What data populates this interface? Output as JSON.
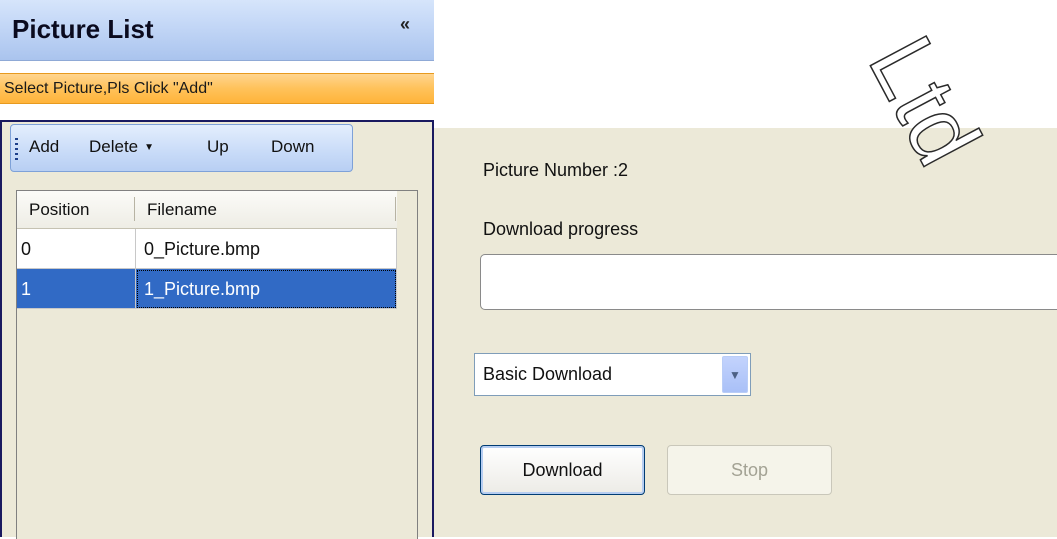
{
  "panel": {
    "title": "Picture List",
    "collapse_icon": "«",
    "hint": "Select Picture,Pls Click \"Add\""
  },
  "toolbar": {
    "add_label": "Add",
    "delete_label": "Delete",
    "up_label": "Up",
    "down_label": "Down"
  },
  "grid": {
    "columns": [
      "Position",
      "Filename"
    ],
    "rows": [
      {
        "position": "0",
        "filename": "0_Picture.bmp",
        "selected": false
      },
      {
        "position": "1",
        "filename": "1_Picture.bmp",
        "selected": true
      }
    ]
  },
  "download": {
    "picture_number_label": "Picture Number :2",
    "progress_label": "Download progress",
    "progress_percent": 0,
    "mode_selected": "Basic Download",
    "download_button": "Download",
    "stop_button": "Stop"
  },
  "watermark": "Ltd",
  "colors": {
    "header_blue": "#c2d6f6",
    "hint_orange": "#ffc25a",
    "selection_blue": "#316ac5",
    "panel_bg": "#ece9d8"
  }
}
